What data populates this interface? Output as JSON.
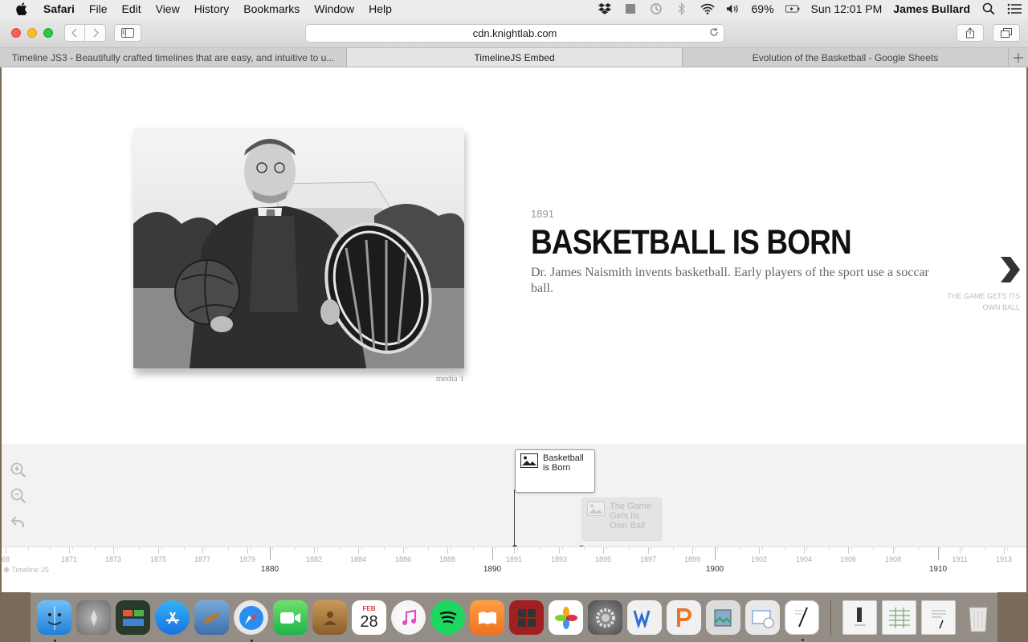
{
  "menubar": {
    "app_name": "Safari",
    "items": [
      "File",
      "Edit",
      "View",
      "History",
      "Bookmarks",
      "Window",
      "Help"
    ],
    "battery": "69%",
    "clock": "Sun 12:01 PM",
    "user": "James Bullard"
  },
  "browser": {
    "url": "cdn.knightlab.com",
    "tabs": [
      {
        "label": "Timeline JS3 - Beautifully crafted timelines that are easy, and intuitive to u...",
        "active": false
      },
      {
        "label": "TimelineJS Embed",
        "active": true
      },
      {
        "label": "Evolution of the Basketball - Google Sheets",
        "active": false
      }
    ]
  },
  "slide": {
    "media_caption": "media 1",
    "date": "1891",
    "headline": "BASKETBALL IS BORN",
    "text": "Dr. James Naismith invents basketball. Early players of the sport use a soccar ball.",
    "next_label": "THE GAME GETS ITS OWN BALL"
  },
  "timeline": {
    "markers": [
      {
        "label": "Basketball is Born",
        "active": true
      },
      {
        "label": "The Game Gets its Own Ball",
        "active": false
      }
    ],
    "minor_ticks": [
      "68",
      "1871",
      "1873",
      "1875",
      "1877",
      "1879",
      "1882",
      "1884",
      "1886",
      "1888",
      "1891",
      "1893",
      "1895",
      "1897",
      "1899",
      "1902",
      "1904",
      "1906",
      "1908",
      "1911",
      "1913"
    ],
    "major_ticks": [
      "1880",
      "1890",
      "1900",
      "1910"
    ],
    "brand": "Timeline JS"
  },
  "colors": {
    "accent_active": "#333333",
    "marker_inactive": "#e4e4e4"
  },
  "dock": {
    "apps": [
      "finder-icon",
      "launchpad-icon",
      "mission-control-icon",
      "app-store-icon",
      "mail-icon",
      "safari-icon",
      "facetime-icon",
      "contacts-icon",
      "calendar-icon",
      "itunes-icon",
      "spotify-icon",
      "ibooks-icon",
      "photo-booth-icon",
      "photos-icon",
      "system-preferences-icon",
      "word-icon",
      "powerpoint-icon",
      "preview-icon",
      "screenshot-icon",
      "textedit-icon",
      "document-icon",
      "spreadsheet-icon",
      "file-icon",
      "trash-icon"
    ],
    "calendar": {
      "month": "FEB",
      "day": "28"
    }
  }
}
